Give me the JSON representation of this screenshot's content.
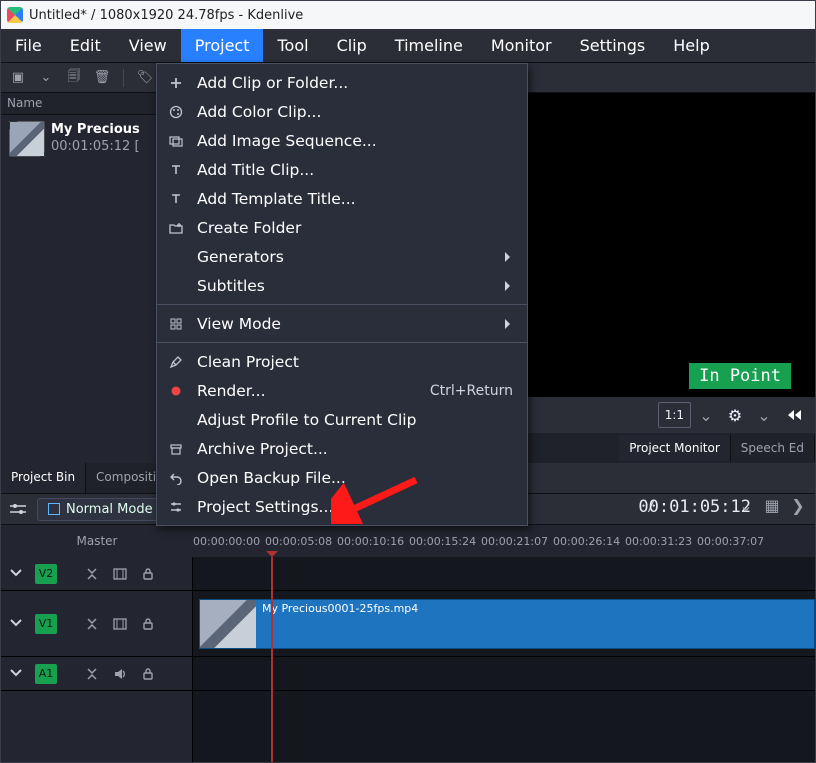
{
  "window_title": "Untitled* / 1080x1920 24.78fps - Kdenlive",
  "menubar": [
    "File",
    "Edit",
    "View",
    "Project",
    "Tool",
    "Clip",
    "Timeline",
    "Monitor",
    "Settings",
    "Help"
  ],
  "menubar_active_index": 3,
  "bin_header": "Name",
  "clip": {
    "name": "My Precious",
    "duration": "00:01:05:12 ["
  },
  "project_menu": [
    {
      "icon": "plus",
      "label": "Add Clip or Folder..."
    },
    {
      "icon": "palette",
      "label": "Add Color Clip..."
    },
    {
      "icon": "images",
      "label": "Add Image Sequence..."
    },
    {
      "icon": "title",
      "label": "Add Title Clip..."
    },
    {
      "icon": "title",
      "label": "Add Template Title..."
    },
    {
      "icon": "folder-new",
      "label": "Create Folder"
    },
    {
      "icon": "",
      "label": "Generators",
      "submenu": true
    },
    {
      "icon": "",
      "label": "Subtitles",
      "submenu": true
    },
    {
      "rule": true
    },
    {
      "icon": "view",
      "label": "View Mode",
      "submenu": true
    },
    {
      "rule": true
    },
    {
      "icon": "broom",
      "label": "Clean Project"
    },
    {
      "icon": "record",
      "label": "Render...",
      "shortcut": "Ctrl+Return"
    },
    {
      "icon": "",
      "label": "Adjust Profile to Current Clip"
    },
    {
      "icon": "archive",
      "label": "Archive Project..."
    },
    {
      "icon": "undo",
      "label": "Open Backup File..."
    },
    {
      "icon": "settings",
      "label": "Project Settings..."
    }
  ],
  "bin_tabs": [
    "Project Bin",
    "Compositions"
  ],
  "monitor_tabs": [
    "Project Monitor",
    "Speech Ed"
  ],
  "mode_label": "Normal Mode",
  "timecode": "00:01:05:12",
  "timecode_sep": "/",
  "zoom_label": "1:1",
  "in_point_label": "In Point",
  "ruler": [
    "00:00:00:00",
    "00:00:05:08",
    "00:00:10:16",
    "00:00:15:24",
    "00:00:21:07",
    "00:00:26:14",
    "00:00:31:23",
    "00:00:37:07"
  ],
  "master_label": "Master",
  "tracks": [
    {
      "name": "V2",
      "kind": "video",
      "small": true
    },
    {
      "name": "V1",
      "kind": "video"
    },
    {
      "name": "A1",
      "kind": "audio",
      "small": true
    }
  ],
  "timeline_clip_label": "My Precious0001-25fps.mp4"
}
